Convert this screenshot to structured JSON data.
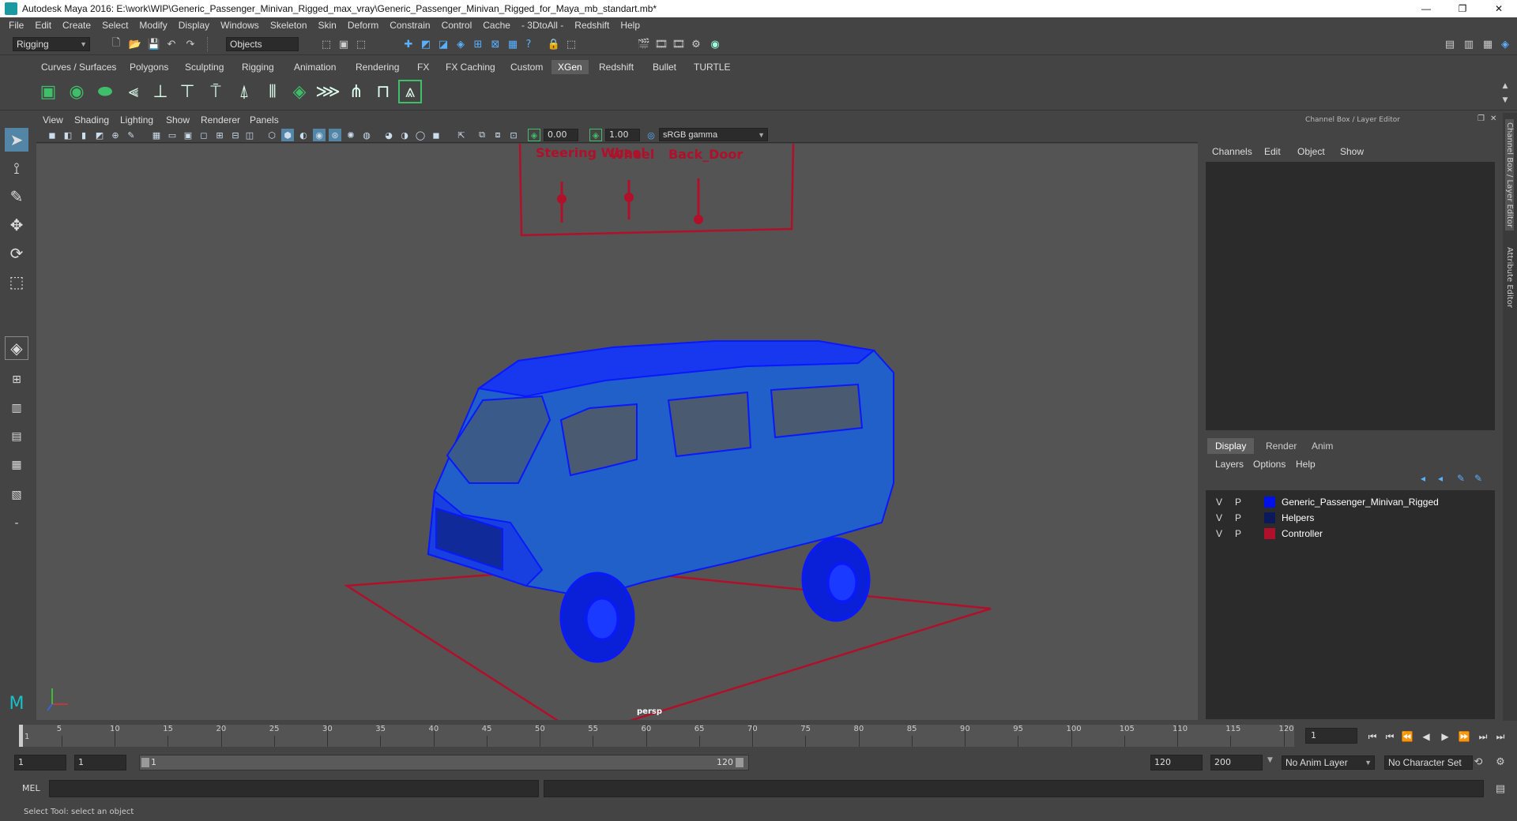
{
  "window": {
    "title": "Autodesk Maya 2016: E:\\work\\WIP\\Generic_Passenger_Minivan_Rigged_max_vray\\Generic_Passenger_Minivan_Rigged_for_Maya_mb_standart.mb*",
    "minimize": "—",
    "maximize": "❐",
    "close": "✕"
  },
  "menu": [
    "File",
    "Edit",
    "Create",
    "Select",
    "Modify",
    "Display",
    "Windows",
    "Skeleton",
    "Skin",
    "Deform",
    "Constrain",
    "Control",
    "Cache",
    "- 3DtoAll -",
    "Redshift",
    "Help"
  ],
  "status": {
    "menuset": "Rigging",
    "selection_mode": "Objects"
  },
  "shelf_tabs": [
    "Curves / Surfaces",
    "Polygons",
    "Sculpting",
    "Rigging",
    "Animation",
    "Rendering",
    "FX",
    "FX Caching",
    "Custom",
    "XGen",
    "Redshift",
    "Bullet",
    "TURTLE"
  ],
  "shelf_active": "XGen",
  "panel_menu": [
    "View",
    "Shading",
    "Lighting",
    "Show",
    "Renderer",
    "Panels"
  ],
  "panel_fields": {
    "exposure": "0.00",
    "gamma": "1.00",
    "colorspace": "sRGB gamma"
  },
  "viewport": {
    "camera": "persp",
    "controller_labels": [
      "Steering Wheel",
      "Wheel",
      "Back_Door"
    ]
  },
  "channel_box": {
    "title": "Channel Box / Layer Editor",
    "menu": [
      "Channels",
      "Edit",
      "Object",
      "Show"
    ]
  },
  "layer_editor": {
    "tabs": [
      "Display",
      "Render",
      "Anim"
    ],
    "active_tab": "Display",
    "menu": [
      "Layers",
      "Options",
      "Help"
    ],
    "layers": [
      {
        "v": "V",
        "p": "P",
        "name": "Generic_Passenger_Minivan_Rigged",
        "color": "#0010e8"
      },
      {
        "v": "V",
        "p": "P",
        "name": "Helpers",
        "color": "#0a1a5a"
      },
      {
        "v": "V",
        "p": "P",
        "name": "Controller",
        "color": "#b0102a"
      }
    ]
  },
  "side_tabs": [
    "Channel Box / Layer Editor",
    "Attribute Editor"
  ],
  "timeline": {
    "ticks": [
      "1",
      "5",
      "10",
      "15",
      "20",
      "25",
      "30",
      "35",
      "40",
      "45",
      "50",
      "55",
      "60",
      "65",
      "70",
      "75",
      "80",
      "85",
      "90",
      "95",
      "100",
      "105",
      "110",
      "115",
      "120"
    ],
    "current_frame": "1"
  },
  "range": {
    "start": "1",
    "playback_start": "1",
    "slider_start": "1",
    "slider_end": "120",
    "playback_end": "120",
    "end": "200",
    "anim_layer": "No Anim Layer",
    "char_set": "No Character Set"
  },
  "command": {
    "lang": "MEL"
  },
  "help_line": "Select Tool: select an object",
  "colors": {
    "wire_blue": "#1030ff",
    "controller_red": "#b0102a",
    "shelf_green": "#3fbf6a"
  }
}
